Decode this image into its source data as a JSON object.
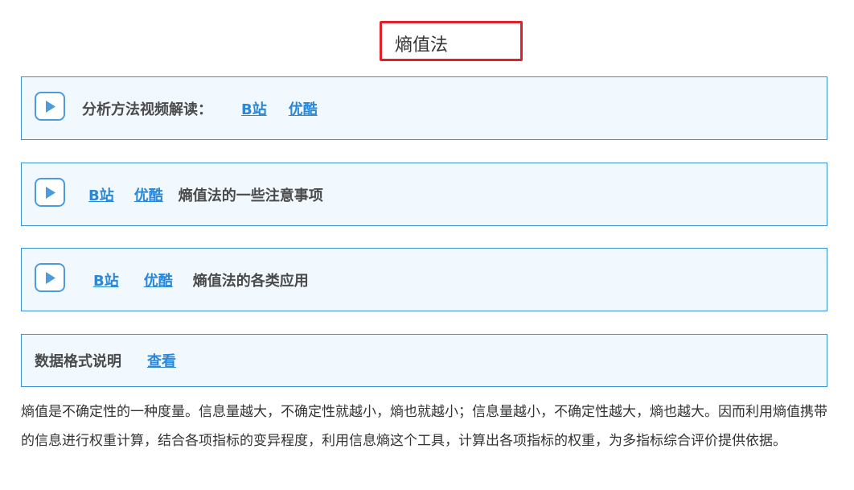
{
  "title": "熵值法",
  "colors": {
    "title_border": "#e0202a",
    "panel_border": "#3d8fd6",
    "panel_bg": "#f1f8fe",
    "link": "#2b87d8"
  },
  "panels": [
    {
      "icon": "play-icon",
      "label": "分析方法视频解读：",
      "links": [
        "B站",
        "优酷"
      ]
    },
    {
      "icon": "play-icon",
      "links": [
        "B站",
        "优酷"
      ],
      "label": "熵值法的一些注意事项"
    },
    {
      "icon": "play-icon",
      "links": [
        "B站",
        "优酷"
      ],
      "label": "熵值法的各类应用"
    },
    {
      "label": "数据格式说明",
      "links": [
        "查看"
      ]
    }
  ],
  "description": "熵值是不确定性的一种度量。信息量越大，不确定性就越小，熵也就越小；信息量越小，不确定性越大，熵也越大。因而利用熵值携带的信息进行权重计算，结合各项指标的变异程度，利用信息熵这个工具，计算出各项指标的权重，为多指标综合评价提供依据。"
}
